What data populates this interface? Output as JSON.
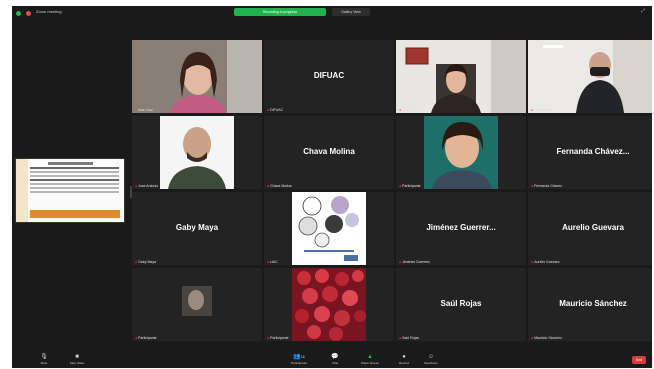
{
  "window": {
    "title": "Zoom meeting"
  },
  "banner": "Recording in progress",
  "view_button": "Gallery View",
  "participants": [
    {
      "name": "",
      "caption": "Ana Cruz"
    },
    {
      "name": "DIFUAC",
      "caption": "DIFUAC"
    },
    {
      "name": "",
      "caption": "Usuario"
    },
    {
      "name": "",
      "caption": "Participante"
    },
    {
      "name": "",
      "caption": "Jose Antonio"
    },
    {
      "name": "Chava Molina",
      "caption": "Chava Molina"
    },
    {
      "name": "",
      "caption": "Participante"
    },
    {
      "name": "Fernanda Chávez...",
      "caption": "Fernanda Chávez"
    },
    {
      "name": "Gaby Maya",
      "caption": "Gaby Maya"
    },
    {
      "name": "",
      "caption": "UAC"
    },
    {
      "name": "Jiménez Guerrer...",
      "caption": "Jiménez Guerrero"
    },
    {
      "name": "Aurelio Guevara",
      "caption": "Aurelio Guevara"
    },
    {
      "name": "",
      "caption": "Participante"
    },
    {
      "name": "",
      "caption": "Participante"
    },
    {
      "name": "Saúl Rojas",
      "caption": "Saúl Rojas"
    },
    {
      "name": "Mauricio Sánchez",
      "caption": "Mauricio Sánchez"
    }
  ],
  "toolbar": {
    "mute": "Mute",
    "video": "Stop Video",
    "participants": "Participants",
    "participants_count": "16",
    "chat": "Chat",
    "share": "Share Screen",
    "record": "Record",
    "reactions": "Reactions",
    "end": "End"
  },
  "colors": {
    "active_border": "#b8d432",
    "share_green": "#22b24c",
    "end_red": "#d93b3b"
  }
}
